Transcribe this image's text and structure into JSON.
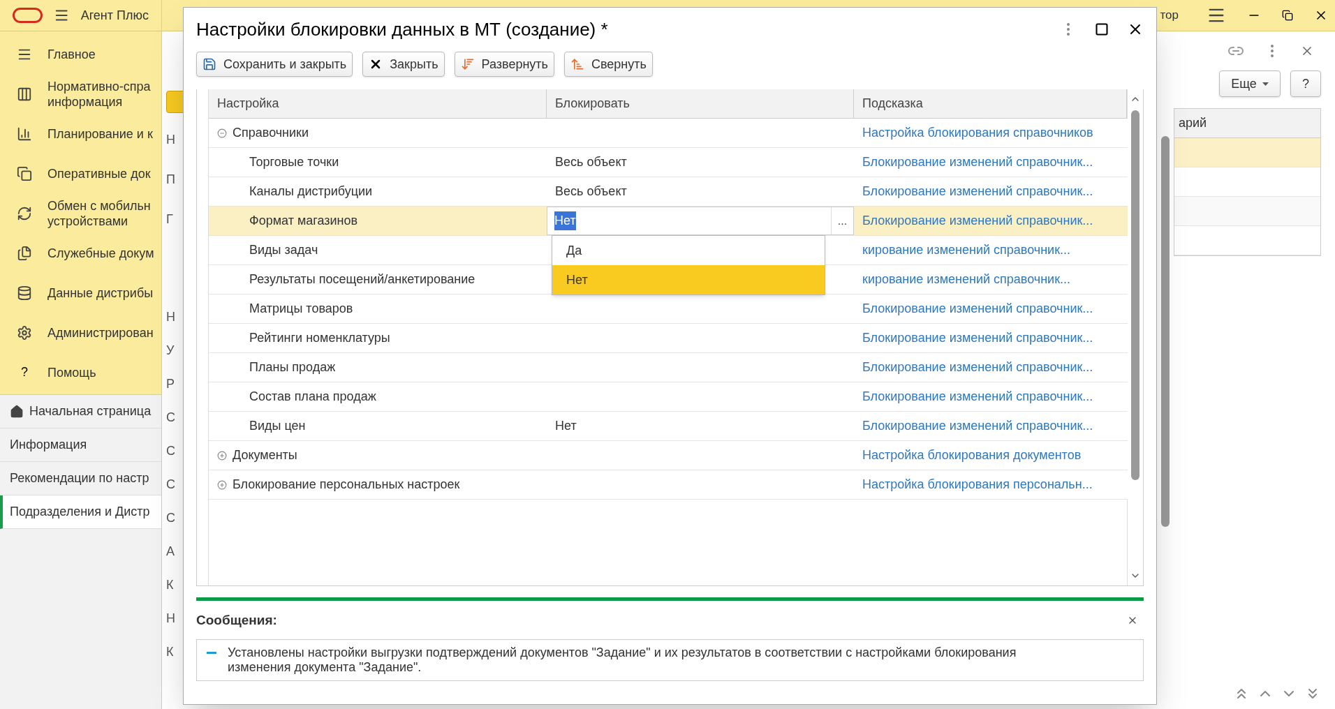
{
  "app": {
    "title": "Агент Плюс",
    "user": "тор"
  },
  "sidebar": {
    "sections": [
      {
        "label": "Главное"
      },
      {
        "label": "Нормативно-спра\nинформация"
      },
      {
        "label": "Планирование и к"
      },
      {
        "label": "Оперативные док"
      },
      {
        "label": "Обмен с мобильн\nустройствами"
      },
      {
        "label": "Служебные докум"
      },
      {
        "label": "Данные дистрибы"
      },
      {
        "label": "Администрирован"
      },
      {
        "label": "Помощь",
        "glyph": "?"
      }
    ],
    "open_pages": [
      {
        "label": "Начальная страница",
        "home": true,
        "selected": false
      },
      {
        "label": "Информация",
        "home": false,
        "selected": false
      },
      {
        "label": "Рекомендации по настр",
        "home": false,
        "selected": false
      },
      {
        "label": "Подразделения и Дистр",
        "home": false,
        "selected": true
      }
    ]
  },
  "background_form": {
    "labels_top": [
      "Н",
      "П",
      "Г"
    ],
    "labels_bottom": [
      "Н",
      "У",
      "Р",
      "С",
      "С",
      "С",
      "С",
      "А",
      "К",
      "Н",
      "К"
    ],
    "more_button": "Еще",
    "help_button": "?",
    "column_header": "арий",
    "rows": [
      {
        "selected": true
      },
      {
        "selected": false
      },
      {
        "selected": false
      },
      {
        "selected": false
      }
    ]
  },
  "dialog": {
    "title": "Настройки блокировки данных в МТ (создание) *",
    "toolbar": [
      {
        "label": "Сохранить и закрыть",
        "kind": "save"
      },
      {
        "label": "Закрыть",
        "kind": "close"
      },
      {
        "label": "Развернуть",
        "kind": "expand"
      },
      {
        "label": "Свернуть",
        "kind": "collapse"
      }
    ],
    "table": {
      "columns": [
        "Настройка",
        "Блокировать",
        "Подсказка"
      ],
      "rows": [
        {
          "name": "Справочники",
          "hint": "Настройка блокирования справочников",
          "expanded": true,
          "selected": false,
          "children": [
            {
              "name": "Торговые точки",
              "block": "Весь объект",
              "hint": "Блокирование изменений справочник...",
              "selected": false
            },
            {
              "name": "Каналы дистрибуции",
              "block": "Весь объект",
              "hint": "Блокирование изменений справочник...",
              "selected": false
            },
            {
              "name": "Формат магазинов",
              "block": "Нет",
              "hint": "Блокирование изменений справочник...",
              "selected": true
            },
            {
              "name": "Виды задач",
              "hint": "кирование изменений справочник...",
              "selected": false
            },
            {
              "name": "Результаты посещений/анкетирование",
              "hint": "кирование изменений справочник...",
              "selected": false
            },
            {
              "name": "Матрицы товаров",
              "hint": "Блокирование изменений справочник...",
              "selected": false
            },
            {
              "name": "Рейтинги номенклатуры",
              "hint": "Блокирование изменений справочник...",
              "selected": false
            },
            {
              "name": "Планы продаж",
              "hint": "Блокирование изменений справочник...",
              "selected": false
            },
            {
              "name": "Состав плана продаж",
              "hint": "Блокирование изменений справочник...",
              "selected": false
            },
            {
              "name": "Виды цен",
              "block": "Нет",
              "hint": "Блокирование изменений справочник...",
              "selected": false
            }
          ]
        },
        {
          "name": "Документы",
          "hint": "Настройка блокирования документов",
          "expanded": false,
          "selected": false
        },
        {
          "name": "Блокирование персональных настроек",
          "hint": "Настройка блокирования персональн...",
          "expanded": false,
          "selected": false
        }
      ]
    },
    "editor_button": "...",
    "dropdown": {
      "items": [
        {
          "label": "Да",
          "selected": false
        },
        {
          "label": "Нет",
          "selected": true
        }
      ]
    },
    "messages": {
      "title": "Сообщения:",
      "items": [
        "Установлены настройки выгрузки подтверждений документов \"Задание\" и их результатов в соответствии с настройками блокирования\nизменения документа \"Задание\"."
      ]
    }
  }
}
